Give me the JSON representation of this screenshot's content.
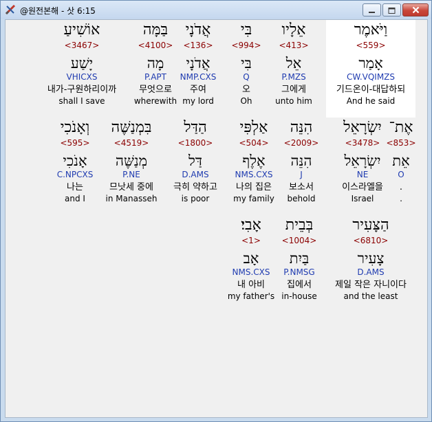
{
  "window": {
    "title": "@원전본해 - 삿 6:15",
    "colors": {
      "code": "#1f3bb0",
      "strongs": "#8b0000",
      "selected_bg": "#ffffff"
    },
    "icons": {
      "app": "pencil-ruler-icon",
      "min": "minimize-icon",
      "max": "maximize-icon",
      "close": "close-icon"
    }
  },
  "rows": [
    [
      {
        "heb": "וַיֹּאמֶר",
        "num": "<559>",
        "lemma": "אָמַר",
        "code": "CW.VQIMZS",
        "ko": "기드온이-대답하되",
        "en": "And he said",
        "selected": true
      },
      {
        "heb": "אֵלָיו",
        "num": "<413>",
        "lemma": "אֵל",
        "code": "P.MZS",
        "ko": "그에게",
        "en": "unto him",
        "selected": false
      },
      {
        "heb": "בִּי",
        "num": "<994>",
        "lemma": "בִּי",
        "code": "Q",
        "ko": "오",
        "en": "Oh",
        "selected": false
      },
      {
        "heb": "אֲדֹנָי",
        "num": "<136>",
        "lemma": "אֲדֹנָי",
        "code": "NMP.CXS",
        "ko": "주여",
        "en": "my lord",
        "selected": false
      },
      {
        "heb": "בַּמָּה",
        "num": "<4100>",
        "lemma": "מָה",
        "code": "P.APT",
        "ko": "무엇으로",
        "en": "wherewith",
        "selected": false
      },
      {
        "heb": "אוֹשִׁיעַ",
        "num": "<3467>",
        "lemma": "יָשַׁע",
        "code": "VHICXS",
        "ko": "내가-구원하리이까",
        "en": "shall I save",
        "selected": false
      }
    ],
    [
      {
        "heb": "אֶת־",
        "num": "<853>",
        "lemma": "אֵת",
        "code": "O",
        "ko": ".",
        "en": ".",
        "selected": false
      },
      {
        "heb": "יִשְׂרָאֵל",
        "num": "<3478>",
        "lemma": "יִשְׂרָאֵל",
        "code": "NE",
        "ko": "이스라엘을",
        "en": "Israel",
        "selected": false
      },
      {
        "heb": "הִנֵּה",
        "num": "<2009>",
        "lemma": "הִנֵּה",
        "code": "J",
        "ko": "보소서",
        "en": "behold",
        "selected": false
      },
      {
        "heb": "אַלְפִּי",
        "num": "<504>",
        "lemma": "אֶלֶף",
        "code": "NMS.CXS",
        "ko": "나의 집은",
        "en": "my family",
        "selected": false
      },
      {
        "heb": "הַדַּל",
        "num": "<1800>",
        "lemma": "דַּל",
        "code": "D.AMS",
        "ko": "극히 약하고",
        "en": "is poor",
        "selected": false
      },
      {
        "heb": "בִּמְנַשֶּׁה",
        "num": "<4519>",
        "lemma": "מְנַשֶּׁה",
        "code": "P.NE",
        "ko": "므낫세 중에",
        "en": "in Manasseh",
        "selected": false
      },
      {
        "heb": "וְאָנֹכִי",
        "num": "<595>",
        "lemma": "אָנֹכִי",
        "code": "C.NPCXS",
        "ko": "나는",
        "en": "and I",
        "selected": false
      }
    ],
    [
      {
        "heb": "הַצָּעִיר",
        "num": "<6810>",
        "lemma": "צָעִיר",
        "code": "D.AMS",
        "ko": "제일 작은 자니이다",
        "en": "and the least",
        "selected": false
      },
      {
        "heb": "בְּבֵית",
        "num": "<1004>",
        "lemma": "בַּיִת",
        "code": "P.NMSG",
        "ko": "집에서",
        "en": "in-house",
        "selected": false
      },
      {
        "heb": "אָבִי׃",
        "num": "<1>",
        "lemma": "אָב",
        "code": "NMS.CXS",
        "ko": "내 아비",
        "en": "my father's",
        "selected": false
      }
    ]
  ]
}
